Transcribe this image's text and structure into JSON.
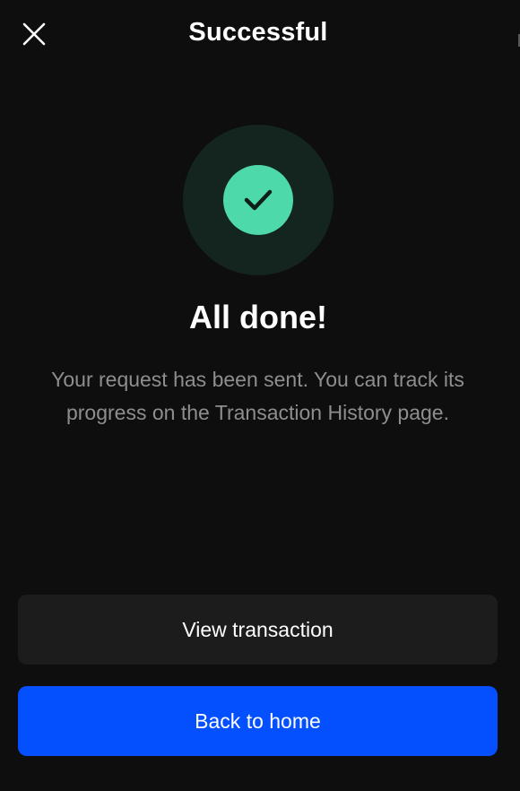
{
  "header": {
    "title": "Successful",
    "close_icon": "close-icon"
  },
  "status": {
    "icon": "checkmark-icon",
    "colors": {
      "ring": "#142520",
      "badge": "#4dd9a9",
      "check": "#0e1e1a"
    }
  },
  "content": {
    "headline": "All done!",
    "message": "Your request has been sent. You can track its progress on the Transaction History page."
  },
  "actions": {
    "view_transaction_label": "View transaction",
    "back_home_label": "Back to home"
  },
  "colors": {
    "background": "#0e0e0e",
    "primary": "#0450ff",
    "secondary": "#1c1c1c",
    "muted_text": "#8e8e8e"
  }
}
